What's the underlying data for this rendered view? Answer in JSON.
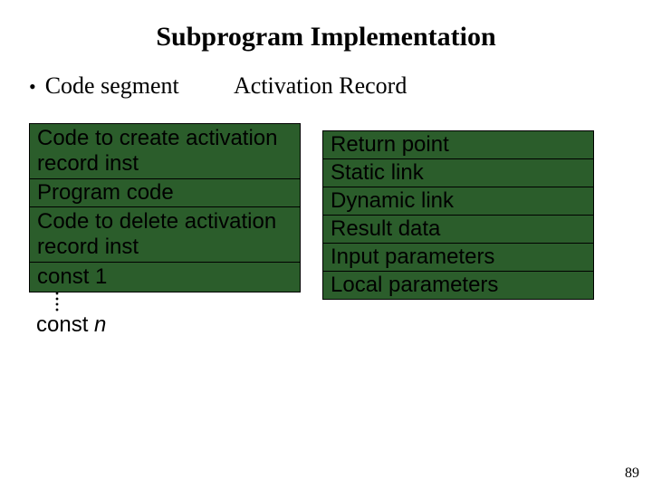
{
  "title": "Subprogram Implementation",
  "headers": {
    "left": "Code segment",
    "right": "Activation Record"
  },
  "code_segment": {
    "row1": "Code to create activation record inst",
    "row2": "Program code",
    "row3": "Code to delete activation record inst",
    "row4": "const 1",
    "tail_prefix": "const ",
    "tail_var": "n"
  },
  "activation_record": {
    "r1": "Return point",
    "r2": "Static link",
    "r3": "Dynamic link",
    "r4": "Result data",
    "r5": "Input parameters",
    "r6": "Local parameters"
  },
  "page_number": "89"
}
